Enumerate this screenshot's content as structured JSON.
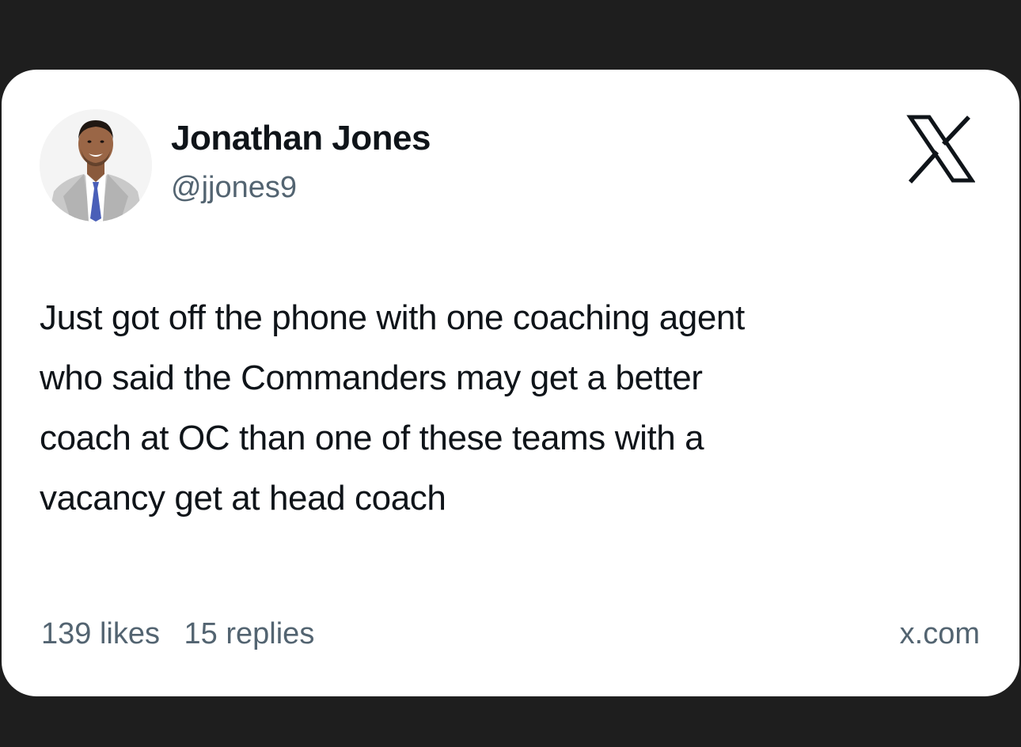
{
  "post": {
    "author_name": "Jonathan Jones",
    "author_handle": "@jjones9",
    "avatar_icon": "profile-photo",
    "platform_icon": "x-logo-icon",
    "text_lines": [
      "Just got off the phone with one coaching agent",
      "who said the Commanders may get a better",
      "coach at OC than one of these teams with a",
      "vacancy get at head coach"
    ],
    "likes": "139 likes",
    "replies": "15 replies",
    "source": "x.com"
  },
  "colors": {
    "background": "#1e1e1e",
    "card": "#ffffff",
    "primary_text": "#0f1419",
    "secondary_text": "#536471"
  }
}
